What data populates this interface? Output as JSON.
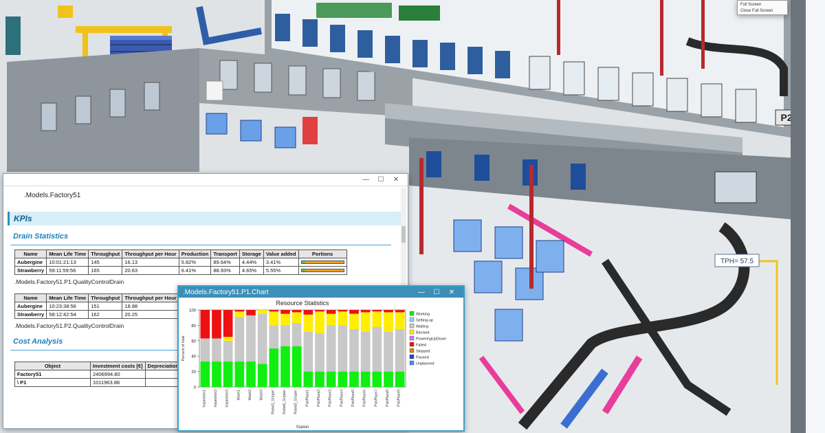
{
  "scene": {
    "zone_sign": "P2",
    "tph_label": "TPH= 57.5"
  },
  "popup_menu": {
    "items": [
      "Full Screen",
      "Close Full Screen"
    ]
  },
  "report_window": {
    "title": "",
    "path": ".Models.Factory51",
    "kpis_heading": "KPIs",
    "drain_heading": "Drain Statistics",
    "drain_columns": [
      "Name",
      "Mean Life Time",
      "Throughput",
      "Throughput per Hour",
      "Production",
      "Transport",
      "Storage",
      "Value added",
      "Portions"
    ],
    "drain_table_1": [
      [
        "Aubergine",
        "10:01:21:13",
        "145",
        "16.13",
        "5.82%",
        "89.64%",
        "4.44%",
        "3.41%"
      ],
      [
        "Strawberry",
        "59:11:59:56",
        "165",
        "20.63",
        "6.41%",
        "88.93%",
        "4.65%",
        "5.55%"
      ]
    ],
    "drain_path_1": ".Models.Factory51.P1.QualityControlDrain",
    "drain_columns_2": [
      "Name",
      "Mean Life Time",
      "Throughput",
      "Throughput per Hour"
    ],
    "drain_table_2": [
      [
        "Aubergine",
        "10:23:38:56",
        "151",
        "18.88"
      ],
      [
        "Strawberry",
        "58:12:42:54",
        "162",
        "20.25"
      ]
    ],
    "drain_path_2": ".Models.Factory51.P2.QualityControlDrain",
    "cost_heading": "Cost Analysis",
    "cost_columns": [
      "Object",
      "Investment costs [€]",
      "Depreciation p... [years]"
    ],
    "cost_rows": [
      [
        "Factory51",
        "2406994.80",
        ""
      ],
      [
        "\\ P1",
        "1011963.88",
        ""
      ]
    ]
  },
  "chart_window": {
    "title": ".Models.Factory51.P1.Chart",
    "chart_data": {
      "type": "bar",
      "stacked": true,
      "title": "Resource Statistics",
      "xlabel": "Station",
      "ylabel": "Percent of total",
      "ylim": [
        0,
        100
      ],
      "yticks": [
        0,
        20,
        40,
        60,
        80,
        100
      ],
      "categories": [
        "Inspection1",
        "Inspection2",
        "Inspection3",
        "Wash1",
        "Wash2",
        "Wash3",
        "Robot1_Gripper",
        "Robot2_Gripper",
        "Robot3_Gripper",
        "PickPlace1",
        "PickPlace2",
        "PickPlace3",
        "PickPlace4",
        "PickPlace5",
        "PickPlace6",
        "PickPlace7",
        "PickPlace8",
        "PickPlace9"
      ],
      "series": [
        {
          "name": "Working",
          "color": "#11ee11",
          "values": [
            33,
            33,
            33,
            33,
            33,
            30,
            50,
            53,
            53,
            20,
            20,
            20,
            20,
            20,
            20,
            20,
            20,
            20
          ]
        },
        {
          "name": "Setting-up",
          "color": "#8fd0ff",
          "values": [
            0,
            0,
            0,
            0,
            0,
            0,
            0,
            0,
            0,
            0,
            0,
            0,
            0,
            0,
            0,
            0,
            0,
            0
          ]
        },
        {
          "name": "Waiting",
          "color": "#c8c8c8",
          "values": [
            30,
            30,
            27,
            58,
            60,
            65,
            30,
            27,
            30,
            52,
            50,
            60,
            60,
            55,
            52,
            58,
            52,
            55
          ]
        },
        {
          "name": "Blocked",
          "color": "#ffee00",
          "values": [
            0,
            0,
            5,
            7,
            0,
            5,
            18,
            15,
            14,
            22,
            28,
            15,
            18,
            20,
            25,
            20,
            25,
            22
          ]
        },
        {
          "name": "PoweringUpDown",
          "color": "#cc77ff",
          "values": [
            0,
            0,
            0,
            0,
            0,
            0,
            0,
            0,
            0,
            0,
            0,
            0,
            0,
            0,
            0,
            0,
            0,
            0
          ]
        },
        {
          "name": "Failed",
          "color": "#ee1111",
          "values": [
            37,
            37,
            35,
            2,
            7,
            0,
            2,
            5,
            3,
            6,
            2,
            5,
            2,
            5,
            3,
            2,
            3,
            3
          ]
        },
        {
          "name": "Stopped",
          "color": "#cc8800",
          "values": [
            0,
            0,
            0,
            0,
            0,
            0,
            0,
            0,
            0,
            0,
            0,
            0,
            0,
            0,
            0,
            0,
            0,
            0
          ]
        },
        {
          "name": "Paused",
          "color": "#2244cc",
          "values": [
            0,
            0,
            0,
            0,
            0,
            0,
            0,
            0,
            0,
            0,
            0,
            0,
            0,
            0,
            0,
            0,
            0,
            0
          ]
        },
        {
          "name": "Unplanned",
          "color": "#5588ee",
          "values": [
            0,
            0,
            0,
            0,
            0,
            0,
            0,
            0,
            0,
            0,
            0,
            0,
            0,
            0,
            0,
            0,
            0,
            0
          ]
        }
      ],
      "grid": false,
      "legend": "right"
    }
  }
}
